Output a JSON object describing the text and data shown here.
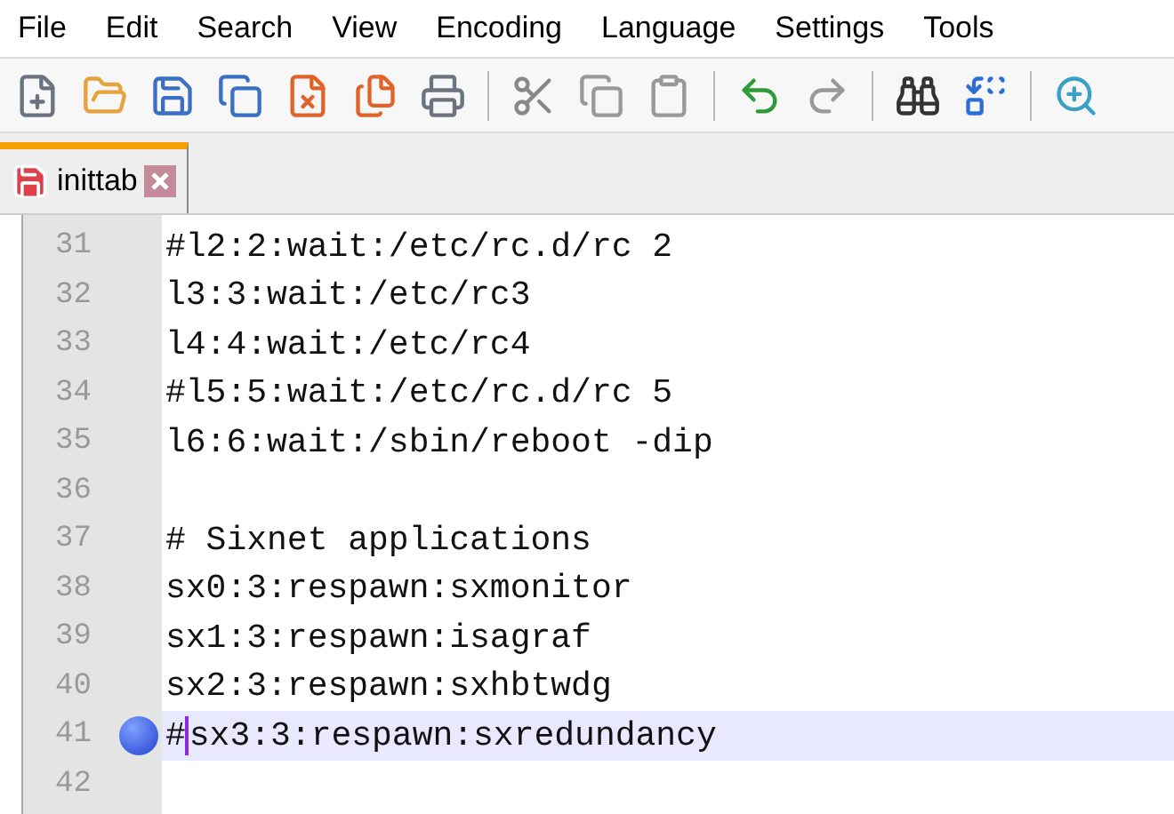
{
  "menu": [
    "File",
    "Edit",
    "Search",
    "View",
    "Encoding",
    "Language",
    "Settings",
    "Tools"
  ],
  "tabs": [
    {
      "label": "inittab",
      "selected": true
    }
  ],
  "lines": [
    {
      "number": "31",
      "text": "#l2:2:wait:/etc/rc.d/rc 2",
      "bookmark": false,
      "current": false
    },
    {
      "number": "32",
      "text": "l3:3:wait:/etc/rc3",
      "bookmark": false,
      "current": false
    },
    {
      "number": "33",
      "text": "l4:4:wait:/etc/rc4",
      "bookmark": false,
      "current": false
    },
    {
      "number": "34",
      "text": "#l5:5:wait:/etc/rc.d/rc 5",
      "bookmark": false,
      "current": false
    },
    {
      "number": "35",
      "text": "l6:6:wait:/sbin/reboot -dip",
      "bookmark": false,
      "current": false
    },
    {
      "number": "36",
      "bookmark": false,
      "current": false
    },
    {
      "number": "37",
      "text": "# Sixnet applications",
      "bookmark": false,
      "current": false
    },
    {
      "number": "38",
      "text": "sx0:3:respawn:sxmonitor",
      "bookmark": false,
      "current": false
    },
    {
      "number": "39",
      "text": "sx1:3:respawn:isagraf",
      "bookmark": false,
      "current": false
    },
    {
      "number": "40",
      "text": "sx2:3:respawn:sxhbtwdg",
      "bookmark": false,
      "current": false
    },
    {
      "number": "41",
      "text_before_caret": "#",
      "text": "sx3:3:respawn:sxredundancy",
      "bookmark": true,
      "current": true
    },
    {
      "number": "42",
      "bookmark": false,
      "current": false
    }
  ]
}
